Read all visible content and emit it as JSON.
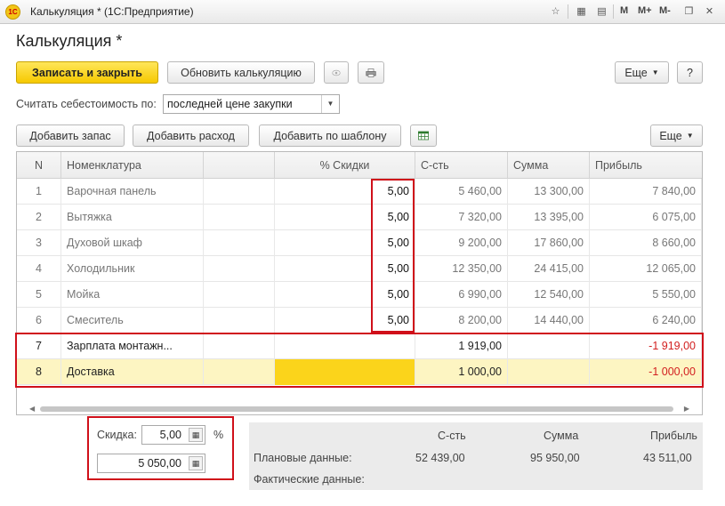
{
  "window": {
    "title": "Калькуляция * (1С:Предприятие)",
    "logo": "1С",
    "m_buttons": [
      "M",
      "M+",
      "M-"
    ],
    "icons": [
      "star-icon",
      "calculator-icon",
      "calendar-icon",
      "restore-icon",
      "close-icon"
    ]
  },
  "page": {
    "title": "Калькуляция *"
  },
  "toolbar": {
    "save_close": "Записать и закрыть",
    "refresh": "Обновить калькуляцию",
    "more": "Еще",
    "help": "?"
  },
  "cost_basis": {
    "label": "Считать себестоимость по:",
    "value": "последней цене закупки"
  },
  "table_toolbar": {
    "add_stock": "Добавить запас",
    "add_expense": "Добавить расход",
    "add_template": "Добавить по шаблону",
    "more": "Еще"
  },
  "table": {
    "columns": [
      "N",
      "Номенклатура",
      "",
      "% Скидки",
      "С-сть",
      "Сумма",
      "Прибыль"
    ],
    "rows": [
      {
        "n": "1",
        "name": "Варочная панель",
        "discount": "5,00",
        "cost": "5 460,00",
        "sum": "13 300,00",
        "profit": "7 840,00"
      },
      {
        "n": "2",
        "name": "Вытяжка",
        "discount": "5,00",
        "cost": "7 320,00",
        "sum": "13 395,00",
        "profit": "6 075,00"
      },
      {
        "n": "3",
        "name": "Духовой шкаф",
        "discount": "5,00",
        "cost": "9 200,00",
        "sum": "17 860,00",
        "profit": "8 660,00"
      },
      {
        "n": "4",
        "name": "Холодильник",
        "discount": "5,00",
        "cost": "12 350,00",
        "sum": "24 415,00",
        "profit": "12 065,00"
      },
      {
        "n": "5",
        "name": "Мойка",
        "discount": "5,00",
        "cost": "6 990,00",
        "sum": "12 540,00",
        "profit": "5 550,00"
      },
      {
        "n": "6",
        "name": "Смеситель",
        "discount": "5,00",
        "cost": "8 200,00",
        "sum": "14 440,00",
        "profit": "6 240,00"
      },
      {
        "n": "7",
        "name": "Зарплата монтажн...",
        "discount": "",
        "cost": "1 919,00",
        "sum": "",
        "profit": "-1 919,00"
      },
      {
        "n": "8",
        "name": "Доставка",
        "discount": "",
        "cost": "1 000,00",
        "sum": "",
        "profit": "-1 000,00"
      }
    ]
  },
  "discount": {
    "label": "Скидка:",
    "percent_value": "5,00",
    "percent_sign": "%",
    "amount_value": "5 050,00"
  },
  "stats": {
    "headers": [
      "С-сть",
      "Сумма",
      "Прибыль"
    ],
    "planned_label": "Плановые данные:",
    "planned": [
      "52 439,00",
      "95 950,00",
      "43 511,00"
    ],
    "actual_label": "Фактические данные:"
  },
  "colors": {
    "accent_yellow": "#f6c900",
    "highlight_red": "#d0101a",
    "negative_red": "#d21f1f"
  }
}
